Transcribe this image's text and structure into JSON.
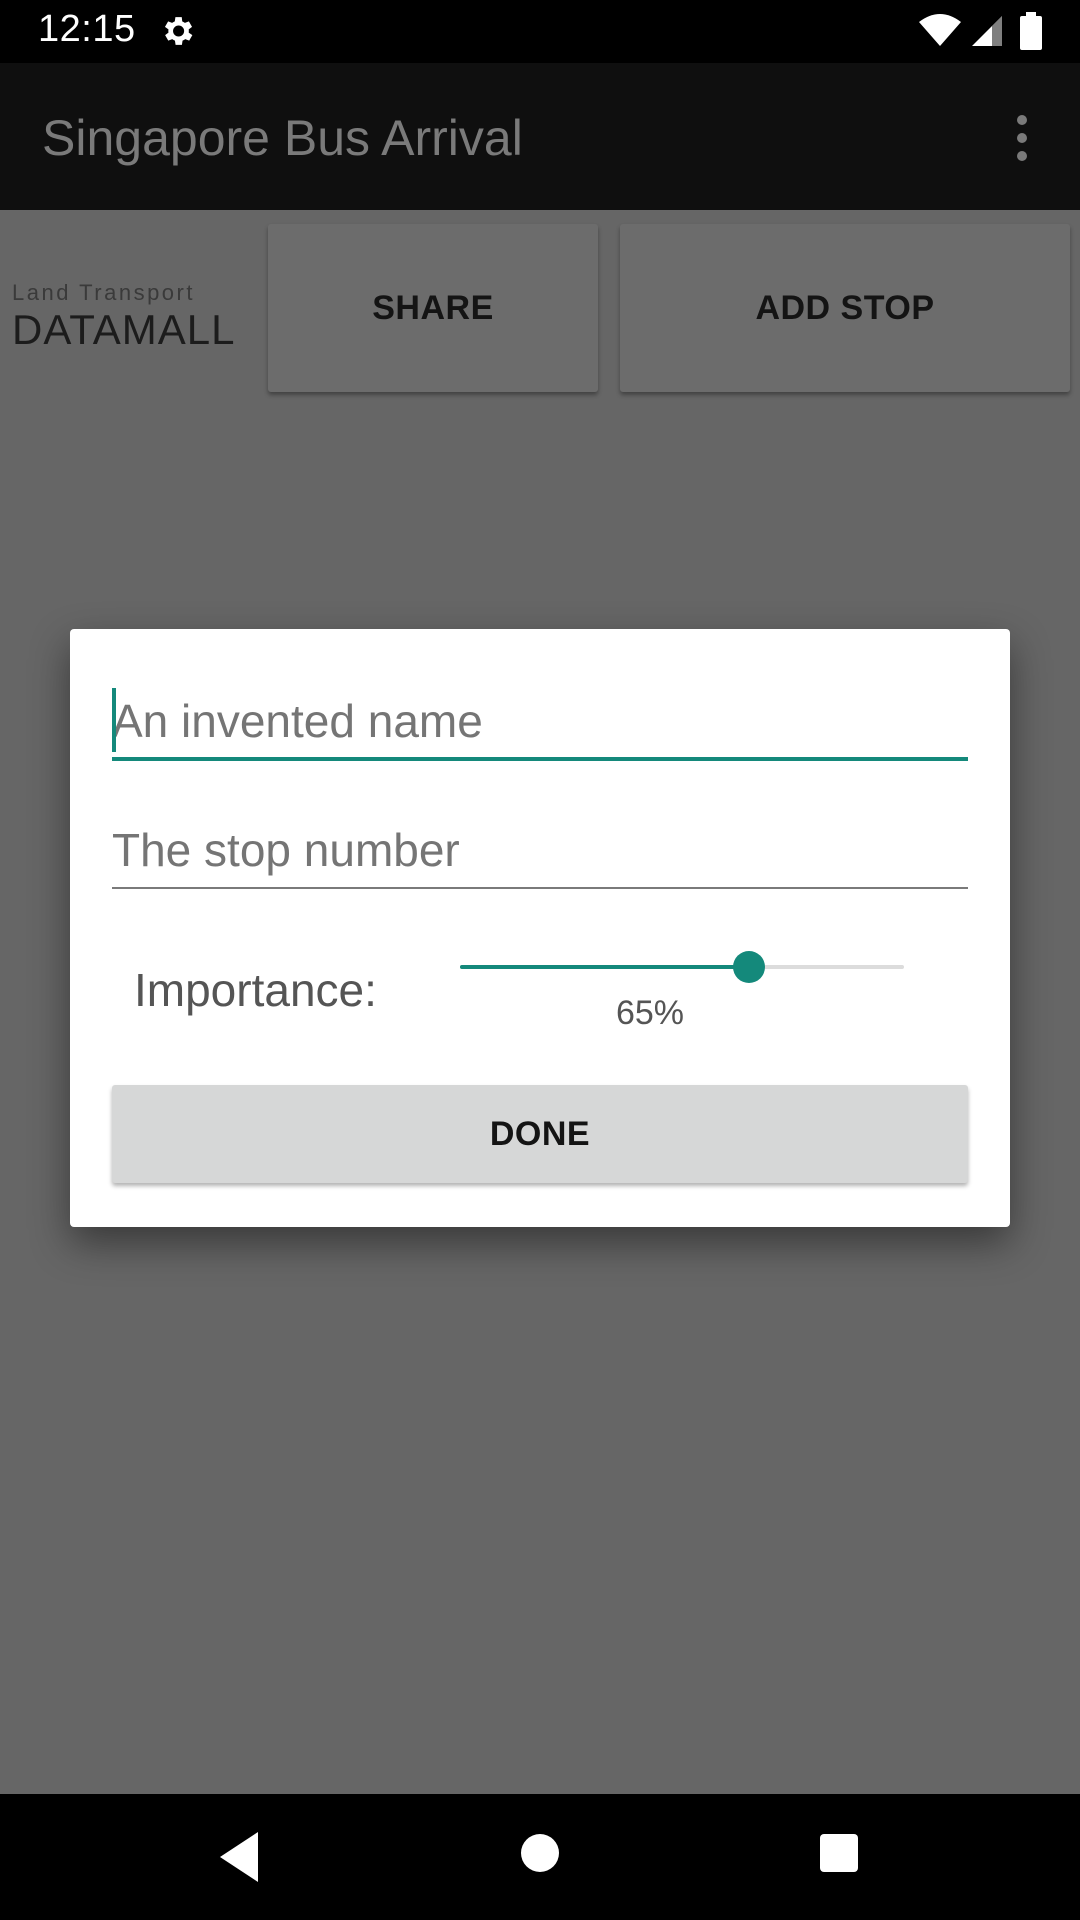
{
  "status_bar": {
    "time": "12:15",
    "icons": [
      "gear-icon",
      "wifi-icon",
      "signal-icon",
      "battery-icon"
    ]
  },
  "app_bar": {
    "title": "Singapore Bus Arrival",
    "menu_icon": "overflow-menu-icon"
  },
  "toolbar": {
    "logo_line1": "Land Transport",
    "logo_line2": "DATAMALL",
    "share_label": "SHARE",
    "add_stop_label": "ADD STOP"
  },
  "dialog": {
    "name_placeholder": "An invented name",
    "name_value": "",
    "stop_placeholder": "The stop number",
    "stop_value": "",
    "importance_label": "Importance:",
    "importance_value": 0.65,
    "importance_text": "65%",
    "done_label": "DONE"
  },
  "nav_bar": {
    "icons": [
      "back-icon",
      "home-icon",
      "recents-icon"
    ]
  },
  "colors": {
    "accent": "#14897b",
    "scrim": "#666666",
    "app_bar": "#0f0f0f",
    "dialog_bg": "#ffffff",
    "button_bg": "#d6d7d7"
  }
}
